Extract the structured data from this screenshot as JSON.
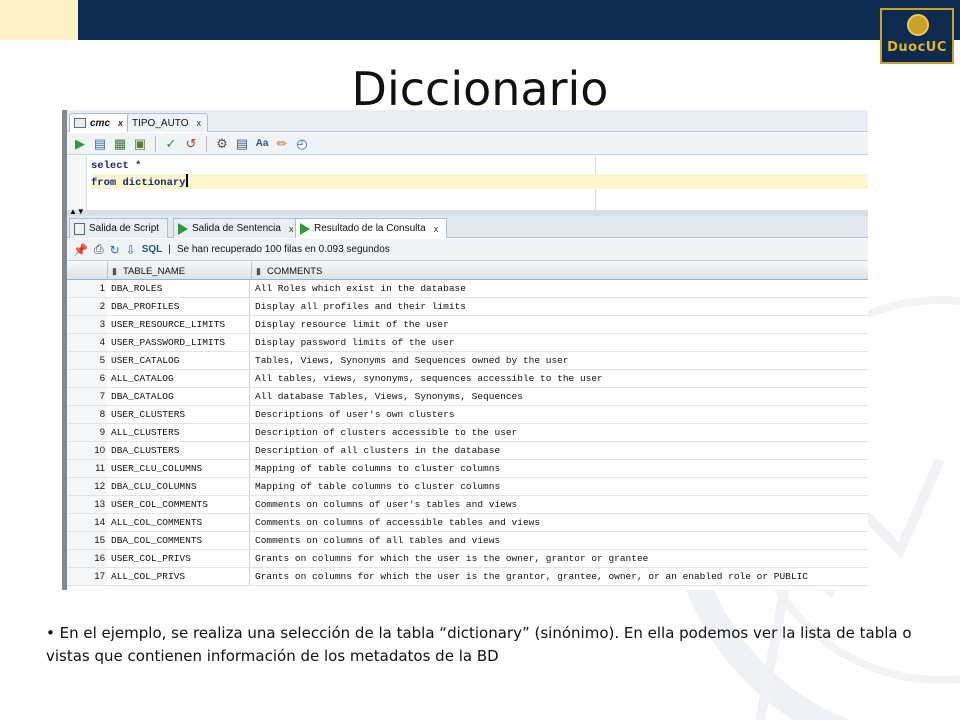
{
  "slide": {
    "title": "Diccionario",
    "logo_text": "DuocUC",
    "caption": "• En el ejemplo, se realiza una selección de la tabla “dictionary” (sinónimo). En ella podemos ver la lista de tabla o vistas que contienen información de los metadatos  de la BD"
  },
  "ide": {
    "doc_tabs": [
      {
        "label": "cmc",
        "icon": "sql-worksheet-icon",
        "active": true
      },
      {
        "label": "TIPO_AUTO",
        "icon": "table-icon",
        "active": false
      }
    ],
    "tab_close": "x",
    "toolbar_icons": [
      "run-statement-icon",
      "run-script-icon",
      "explain-plan-icon",
      "autotrace-icon",
      "commit-icon",
      "rollback-icon",
      "unshared-sql-worksheet-icon",
      "sql-tuning-advisor-icon",
      "format-icon",
      "clear-icon",
      "history-icon"
    ],
    "editor": {
      "lines": [
        "select *",
        "from dictionary"
      ]
    },
    "output_tabs": [
      {
        "label": "Salida de Script",
        "icon": "script-output-icon"
      },
      {
        "label": "Salida de Sentencia",
        "icon": "statement-output-icon"
      },
      {
        "label": "Resultado de la Consulta",
        "icon": "query-result-icon"
      }
    ],
    "result_bar": {
      "sql_label": "SQL",
      "separator": "|",
      "status": "Se han recuperado 100 filas en 0.093 segundos"
    },
    "grid": {
      "columns": [
        "TABLE_NAME",
        "COMMENTS"
      ],
      "rows": [
        {
          "n": "1",
          "table": "DBA_ROLES",
          "comment": "All Roles which exist in the database"
        },
        {
          "n": "2",
          "table": "DBA_PROFILES",
          "comment": "Display all profiles and their limits"
        },
        {
          "n": "3",
          "table": "USER_RESOURCE_LIMITS",
          "comment": "Display resource limit of the user"
        },
        {
          "n": "4",
          "table": "USER_PASSWORD_LIMITS",
          "comment": "Display password limits of the user"
        },
        {
          "n": "5",
          "table": "USER_CATALOG",
          "comment": "Tables, Views, Synonyms and Sequences owned by the user"
        },
        {
          "n": "6",
          "table": "ALL_CATALOG",
          "comment": "All tables, views, synonyms, sequences accessible to the user"
        },
        {
          "n": "7",
          "table": "DBA_CATALOG",
          "comment": "All database Tables, Views, Synonyms, Sequences"
        },
        {
          "n": "8",
          "table": "USER_CLUSTERS",
          "comment": "Descriptions of user's own clusters"
        },
        {
          "n": "9",
          "table": "ALL_CLUSTERS",
          "comment": "Description of clusters accessible to the user"
        },
        {
          "n": "10",
          "table": "DBA_CLUSTERS",
          "comment": "Description of all clusters in the database"
        },
        {
          "n": "11",
          "table": "USER_CLU_COLUMNS",
          "comment": "Mapping of table columns to cluster columns"
        },
        {
          "n": "12",
          "table": "DBA_CLU_COLUMNS",
          "comment": "Mapping of table columns to cluster columns"
        },
        {
          "n": "13",
          "table": "USER_COL_COMMENTS",
          "comment": "Comments on columns of user's tables and views"
        },
        {
          "n": "14",
          "table": "ALL_COL_COMMENTS",
          "comment": "Comments on columns of accessible tables and views"
        },
        {
          "n": "15",
          "table": "DBA_COL_COMMENTS",
          "comment": "Comments on columns of all tables and views"
        },
        {
          "n": "16",
          "table": "USER_COL_PRIVS",
          "comment": "Grants on columns for which the user is the owner, grantor or grantee"
        },
        {
          "n": "17",
          "table": "ALL_COL_PRIVS",
          "comment": "Grants on columns for which the user is the grantor, grantee, owner, or an enabled role or PUBLIC"
        }
      ]
    }
  },
  "colors": {
    "header_navy": "#0e2a4e",
    "header_cream": "#fdf3c6",
    "logo_gold": "#c9a227",
    "sql_keyword": "#1a2a7a",
    "current_line": "#fdf6cf",
    "run_green": "#2e9a3c"
  }
}
